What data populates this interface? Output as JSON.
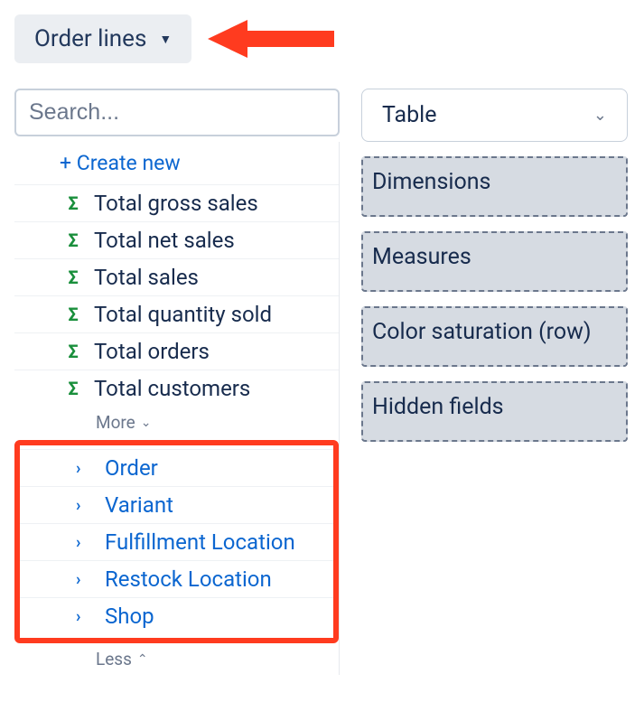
{
  "dataSource": {
    "label": "Order lines"
  },
  "search": {
    "placeholder": "Search..."
  },
  "createNew": {
    "label": "+ Create new"
  },
  "metrics": [
    {
      "label": "Total gross sales"
    },
    {
      "label": "Total net sales"
    },
    {
      "label": "Total sales"
    },
    {
      "label": "Total quantity sold"
    },
    {
      "label": "Total orders"
    },
    {
      "label": "Total customers"
    }
  ],
  "moreLabel": "More",
  "lessLabel": "Less",
  "groups": [
    {
      "label": "Order"
    },
    {
      "label": "Variant"
    },
    {
      "label": "Fulfillment Location"
    },
    {
      "label": "Restock Location"
    },
    {
      "label": "Shop"
    }
  ],
  "viz": {
    "selected": "Table"
  },
  "dropZones": {
    "dimensions": "Dimensions",
    "measures": "Measures",
    "colorSaturation": "Color saturation (row)",
    "hiddenFields": "Hidden fields"
  },
  "colors": {
    "highlight": "#ff3b1f"
  }
}
